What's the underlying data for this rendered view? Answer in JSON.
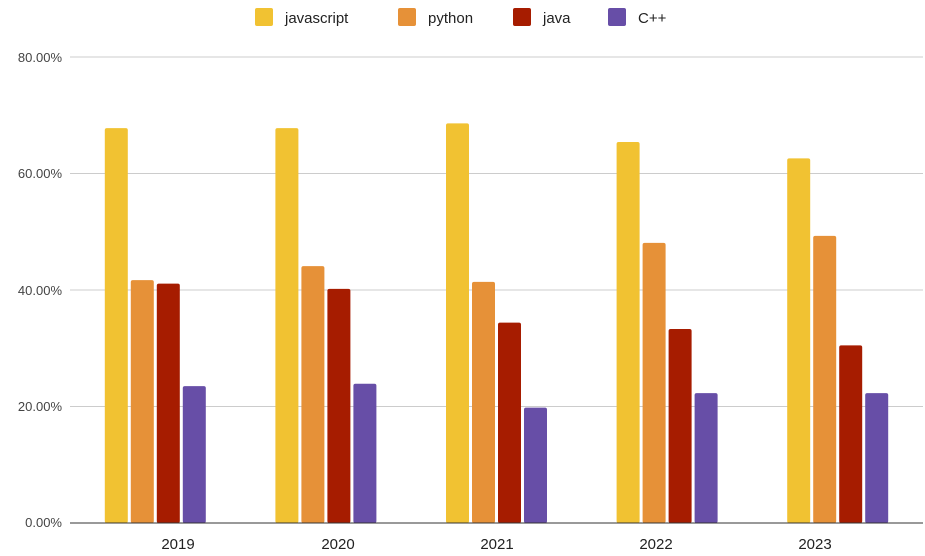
{
  "chart_data": {
    "type": "bar",
    "categories": [
      "2019",
      "2020",
      "2021",
      "2022",
      "2023"
    ],
    "series": [
      {
        "name": "javascript",
        "color": "#f1c232",
        "values": [
          67.8,
          67.8,
          68.6,
          65.4,
          62.6
        ]
      },
      {
        "name": "python",
        "color": "#e69138",
        "values": [
          41.7,
          44.1,
          41.4,
          48.1,
          49.3
        ]
      },
      {
        "name": "java",
        "color": "#a61c00",
        "values": [
          41.1,
          40.2,
          34.4,
          33.3,
          30.5
        ]
      },
      {
        "name": "C++",
        "color": "#674ea7",
        "values": [
          23.5,
          23.9,
          19.8,
          22.3,
          22.3
        ]
      }
    ],
    "y_ticks": [
      "0.00%",
      "20.00%",
      "40.00%",
      "60.00%",
      "80.00%"
    ],
    "ylim": [
      0,
      80
    ],
    "grid": true,
    "legend_position": "top-center"
  }
}
